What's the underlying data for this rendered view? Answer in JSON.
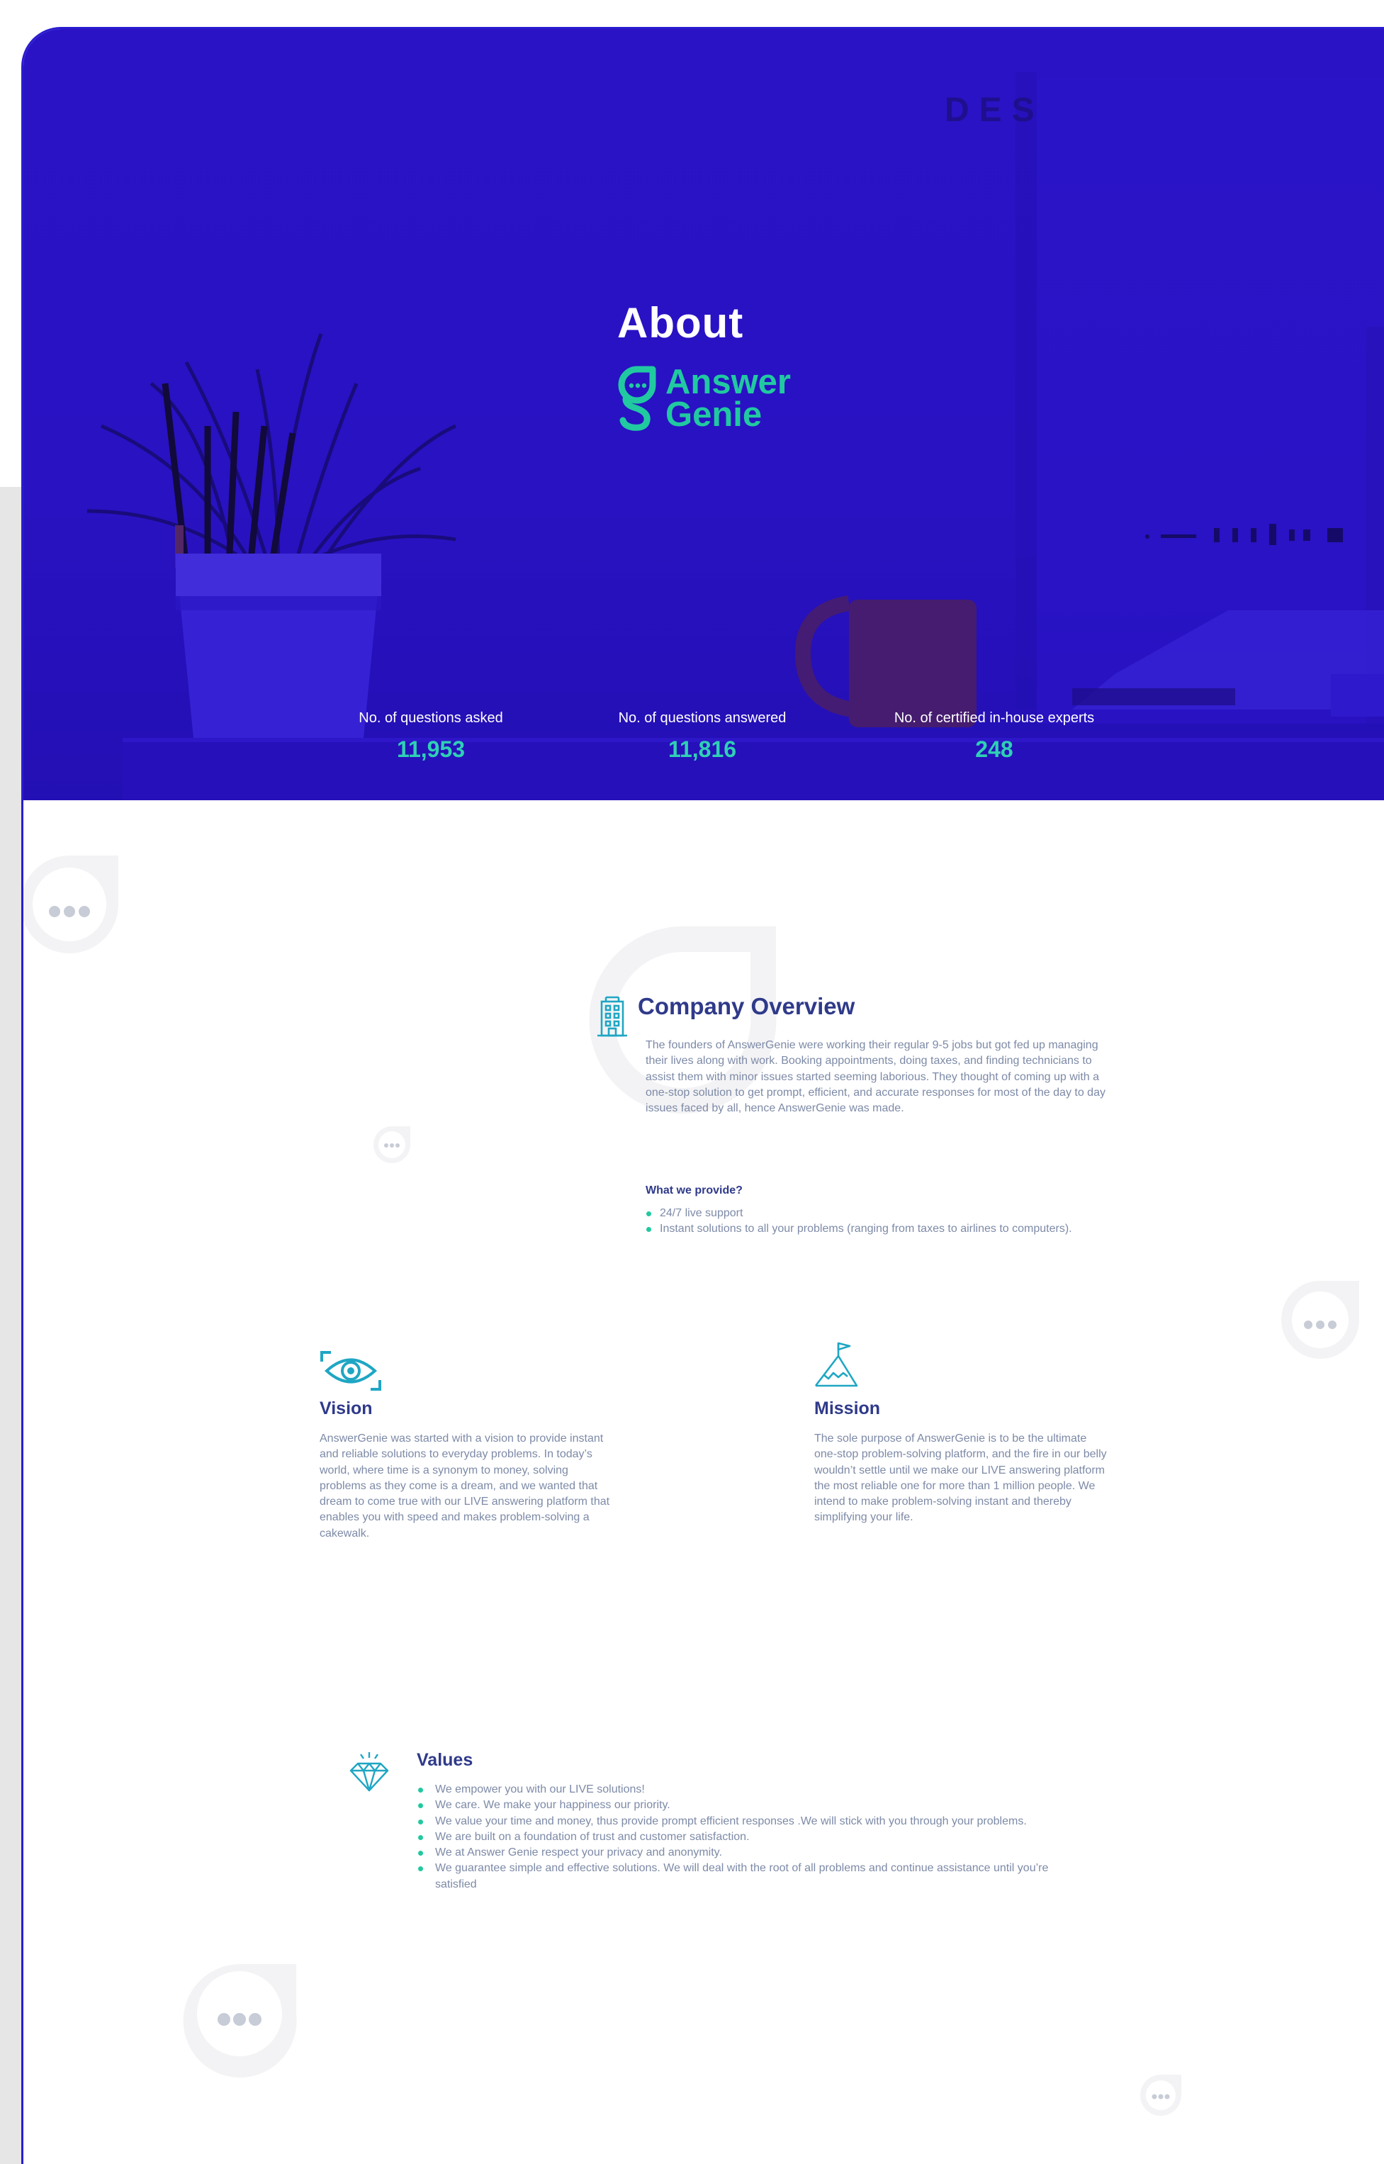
{
  "hero": {
    "title": "About",
    "brand": {
      "line1": "Answer",
      "line2": "Genie"
    },
    "stats": [
      {
        "label": "No. of questions asked",
        "value": "11,953"
      },
      {
        "label": "No. of questions answered",
        "value": "11,816"
      },
      {
        "label": "No. of certified in-house experts",
        "value": "248"
      }
    ]
  },
  "company_overview": {
    "title": "Company Overview",
    "text": "The founders of AnswerGenie were working their regular 9-5 jobs but got fed up managing their lives along with work. Booking appointments, doing taxes, and finding technicians to assist them with minor issues started seeming laborious. They thought of coming up with a one-stop solution to get prompt, efficient, and accurate responses for most of the day to day issues faced by all, hence AnswerGenie was made.",
    "what_we_provide": {
      "title": "What we provide?",
      "items": [
        "24/7 live support",
        "Instant solutions to all your problems (ranging from taxes to airlines to computers)."
      ]
    }
  },
  "vision": {
    "title": "Vision",
    "text": "AnswerGenie was started with a vision to provide instant and reliable solutions to everyday problems. In today’s world, where time is a synonym to money, solving problems as they come is a dream, and we wanted that dream to come true with our LIVE answering platform that enables you with speed and makes problem-solving a cakewalk."
  },
  "mission": {
    "title": "Mission",
    "text": "The sole purpose of AnswerGenie is to be the ultimate one-stop problem-solving platform, and the fire in our belly wouldn’t settle until we make our LIVE answering platform the most reliable one for more than 1 million people. We intend to make problem-solving instant and thereby simplifying your life."
  },
  "values": {
    "title": "Values",
    "items": [
      "We empower you with our LIVE solutions!",
      "We care. We make your happiness our priority.",
      "We value your time and money, thus provide prompt efficient responses .We will stick with you through your problems.",
      "We are built on a foundation of trust and customer satisfaction.",
      "We at Answer Genie respect your privacy and anonymity.",
      "We guarantee simple and effective solutions. We will deal with the root of all problems and continue assistance until you’re satisfied"
    ]
  },
  "colors": {
    "hero_blue": "#2a13c4",
    "accent_green": "#21c9a0",
    "heading_navy": "#2f3a8a",
    "body_gray": "#7d8aa7",
    "icon_teal": "#1fa6c4"
  },
  "icons": [
    "building-icon",
    "eye-icon",
    "mountain-flag-icon",
    "diamond-icon",
    "chat-bubble-icon",
    "brand-logo-icon"
  ]
}
